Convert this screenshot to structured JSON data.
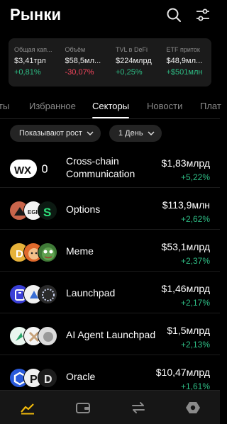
{
  "header": {
    "title": "Рынки",
    "search_icon": "search-icon",
    "filter_icon": "sliders-icon"
  },
  "stats": [
    {
      "label": "Общая кап...",
      "value": "$3,41трл",
      "change": "+0,81%",
      "trend": "up"
    },
    {
      "label": "Объём",
      "value": "$58,5мл...",
      "change": "-30,07%",
      "trend": "down"
    },
    {
      "label": "TVL в DeFi",
      "value": "$224млрд",
      "change": "+0,25%",
      "trend": "up"
    },
    {
      "label": "ETF приток",
      "value": "$48,9мл...",
      "change": "+$501млн",
      "trend": "up"
    }
  ],
  "tabs": [
    {
      "label": "ты"
    },
    {
      "label": "Избранное"
    },
    {
      "label": "Секторы",
      "active": true
    },
    {
      "label": "Новости"
    },
    {
      "label": "Плат"
    }
  ],
  "filters": {
    "sort_label": "Показывают рост",
    "period_label": "1 День"
  },
  "sectors": [
    {
      "name": "Cross-chain",
      "name2": "Communication",
      "price": "$1,83млрд",
      "change": "+5,22%"
    },
    {
      "name": "Options",
      "name2": "",
      "price": "$113,9млн",
      "change": "+2,62%"
    },
    {
      "name": "Meme",
      "name2": "",
      "price": "$53,1млрд",
      "change": "+2,37%"
    },
    {
      "name": "Launchpad",
      "name2": "",
      "price": "$1,46млрд",
      "change": "+2,17%"
    },
    {
      "name": "AI Agent Launchpad",
      "name2": "",
      "price": "$1,5млрд",
      "change": "+2,13%"
    },
    {
      "name": "Oracle",
      "name2": "",
      "price": "$10,47млрд",
      "change": "+1,61%"
    }
  ],
  "colors": {
    "up": "#2ebd85",
    "down": "#f6465d",
    "accent": "#f0b90b",
    "background": "#000000"
  },
  "bottom_nav": [
    "markets-icon",
    "wallet-icon",
    "swap-icon",
    "settings-hexagon-icon"
  ]
}
